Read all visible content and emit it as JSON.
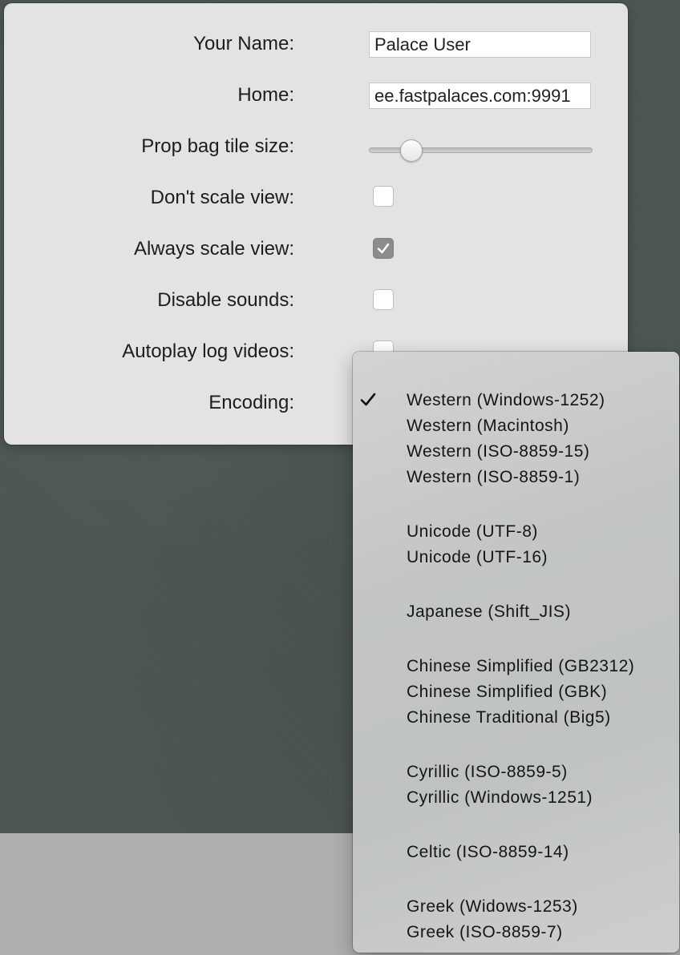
{
  "preferences": {
    "your_name_label": "Your Name:",
    "your_name_value": "Palace User",
    "home_label": "Home:",
    "home_value": "ee.fastpalaces.com:9991",
    "prop_bag_label": "Prop bag tile size:",
    "prop_bag_level": 0.19,
    "dont_scale_label": "Don't scale view:",
    "dont_scale_checked": false,
    "always_scale_label": "Always scale view:",
    "always_scale_checked": true,
    "disable_sounds_label": "Disable sounds:",
    "disable_sounds_checked": false,
    "autoplay_label": "Autoplay log videos:",
    "autoplay_checked": false,
    "encoding_label": "Encoding:"
  },
  "encoding_menu": {
    "selected": "Western (Windows-1252)",
    "check_icon": "checkmark-icon",
    "items": [
      "Western (Windows-1252)",
      "Western (Macintosh)",
      "Western (ISO-8859-15)",
      "Western (ISO-8859-1)",
      "Unicode (UTF-8)",
      "Unicode (UTF-16)",
      "Japanese (Shift_JIS)",
      "Chinese Simplified (GB2312)",
      "Chinese Simplified (GBK)",
      "Chinese Traditional (Big5)",
      "Cyrillic (ISO-8859-5)",
      "Cyrillic (Windows-1251)",
      "Celtic (ISO-8859-14)",
      "Greek (Widows-1253)",
      "Greek (ISO-8859-7)"
    ]
  },
  "colors": {
    "desktop_background": "#4c5650",
    "panel_background": "#e3e3e3",
    "checked_checkbox": "#8c8c8c"
  }
}
